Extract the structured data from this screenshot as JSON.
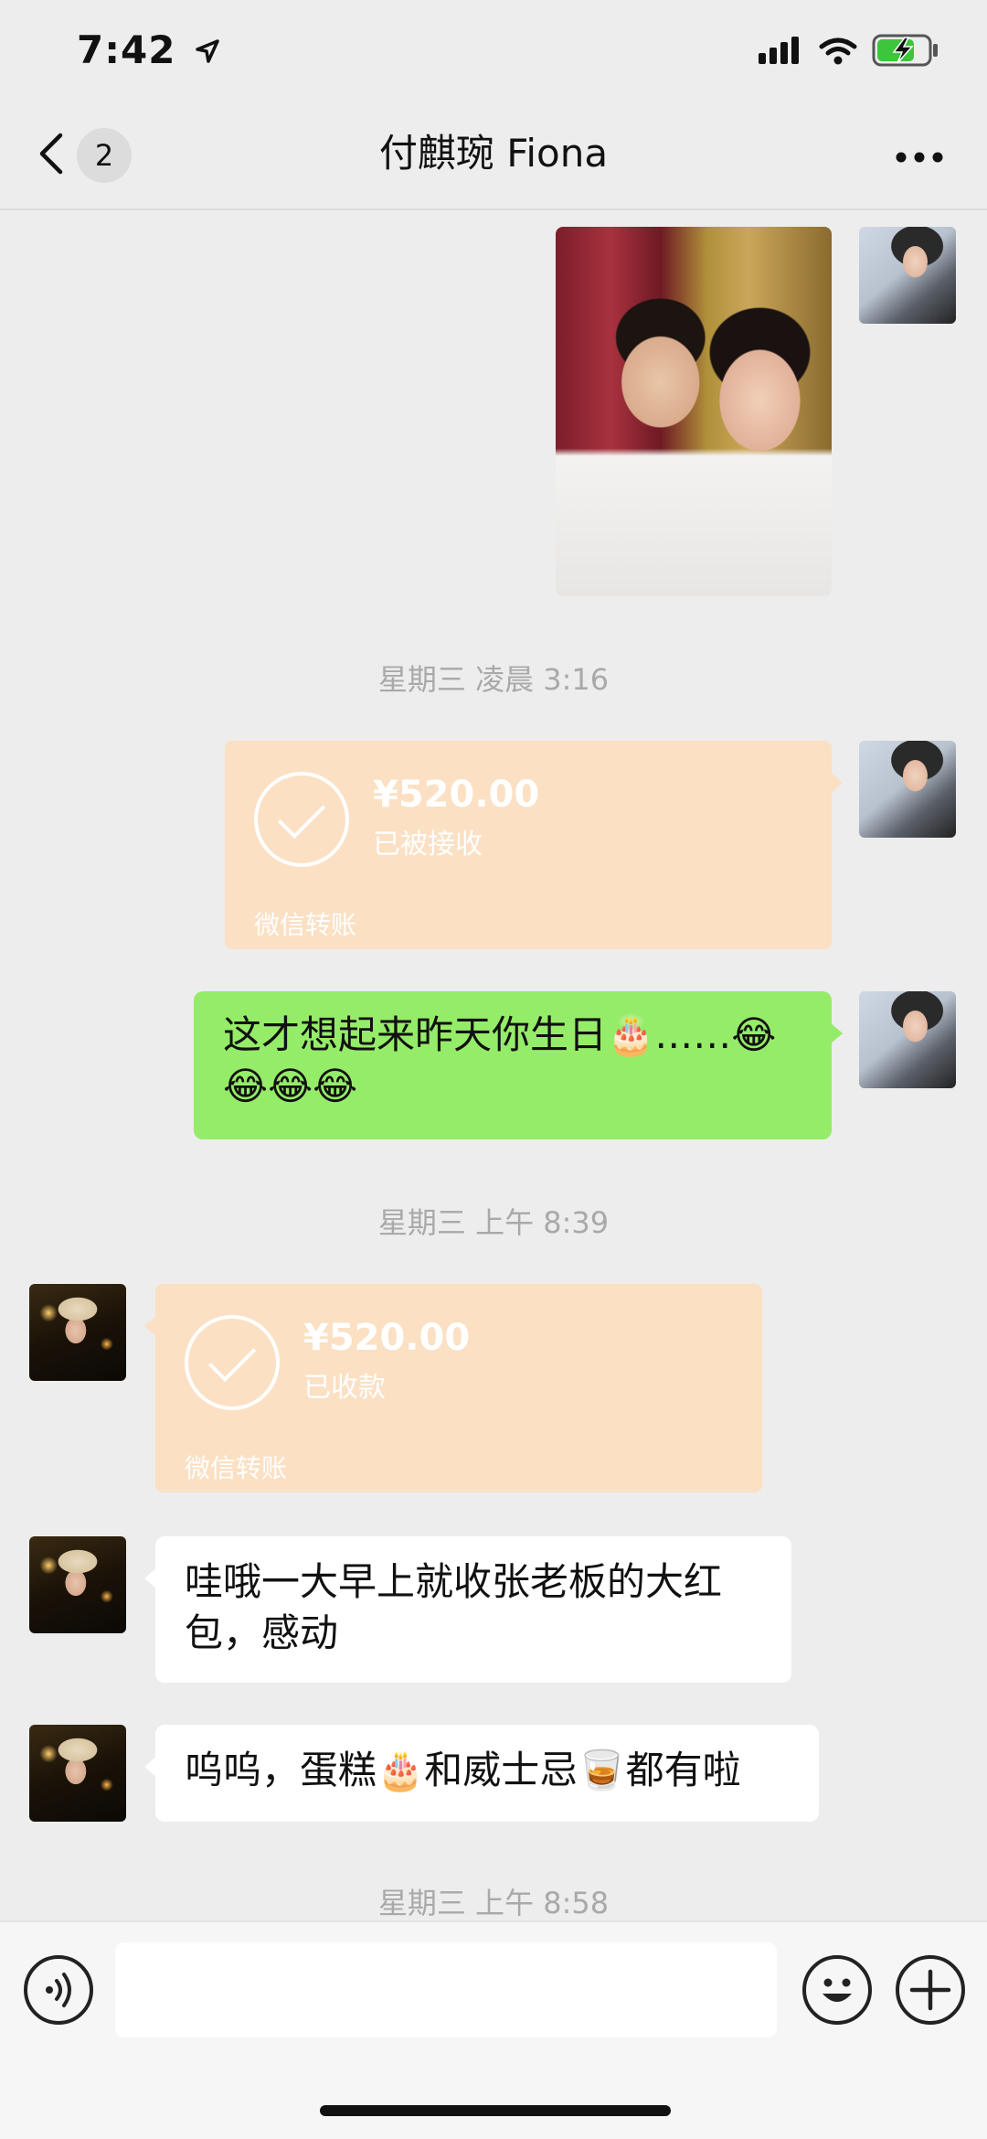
{
  "status_bar": {
    "time": "7:42"
  },
  "header": {
    "back_count": "2",
    "title": "付麒琬 Fiona"
  },
  "messages": {
    "sep1": "星期三 凌晨 3:16",
    "transfer1": {
      "amount": "¥520.00",
      "status": "已被接收",
      "label": "微信转账"
    },
    "green_text": "这才想起来昨天你生日🎂……😂😂😂😂",
    "sep2": "星期三 上午 8:39",
    "transfer2": {
      "amount": "¥520.00",
      "status": "已收款",
      "label": "微信转账"
    },
    "white_text1": "哇哦一大早上就收张老板的大红包，感动",
    "white_text2": "呜呜，蛋糕🎂和威士忌🥃都有啦",
    "sep3": "星期三 上午 8:58"
  },
  "colors": {
    "background": "#ededed",
    "green_bubble": "#95ec69",
    "transfer_card": "#fbe0c3",
    "white_bubble": "#ffffff"
  },
  "icons": [
    "location-arrow-icon",
    "signal-icon",
    "wifi-icon",
    "battery-charging-icon",
    "back-chevron-icon",
    "more-icon",
    "voice-icon",
    "emoji-icon",
    "plus-icon",
    "check-circle-icon"
  ]
}
